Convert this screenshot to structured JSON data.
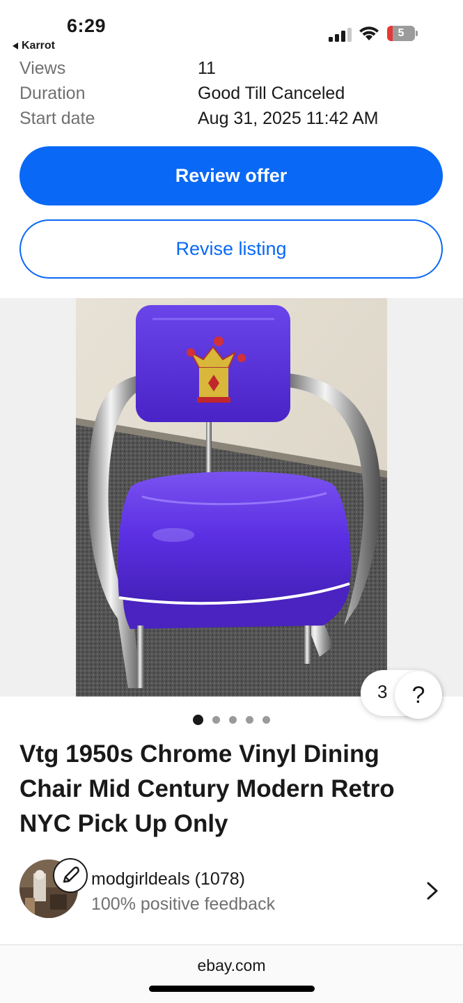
{
  "status_bar": {
    "time": "6:29",
    "back_app": "Karrot",
    "battery_level": "5"
  },
  "details": [
    {
      "label": "Views",
      "value": "11"
    },
    {
      "label": "Duration",
      "value": "Good Till Canceled"
    },
    {
      "label": "Start date",
      "value": "Aug 31, 2025 11:42 AM"
    }
  ],
  "actions": {
    "review_offer": "Review offer",
    "revise_listing": "Revise listing"
  },
  "gallery": {
    "counter": "3",
    "help": "?",
    "dot_count": 5,
    "active_dot": 0
  },
  "listing": {
    "title": "Vtg 1950s Chrome Vinyl Dining Chair Mid Century Modern Retro NYC Pick Up Only"
  },
  "seller": {
    "name": "modgirldeals (1078)",
    "feedback": "100% positive feedback"
  },
  "browser": {
    "url": "ebay.com"
  },
  "colors": {
    "primary": "#0968f6",
    "chair_vinyl": "#5a2de0",
    "text": "#191919",
    "muted": "#707070"
  }
}
